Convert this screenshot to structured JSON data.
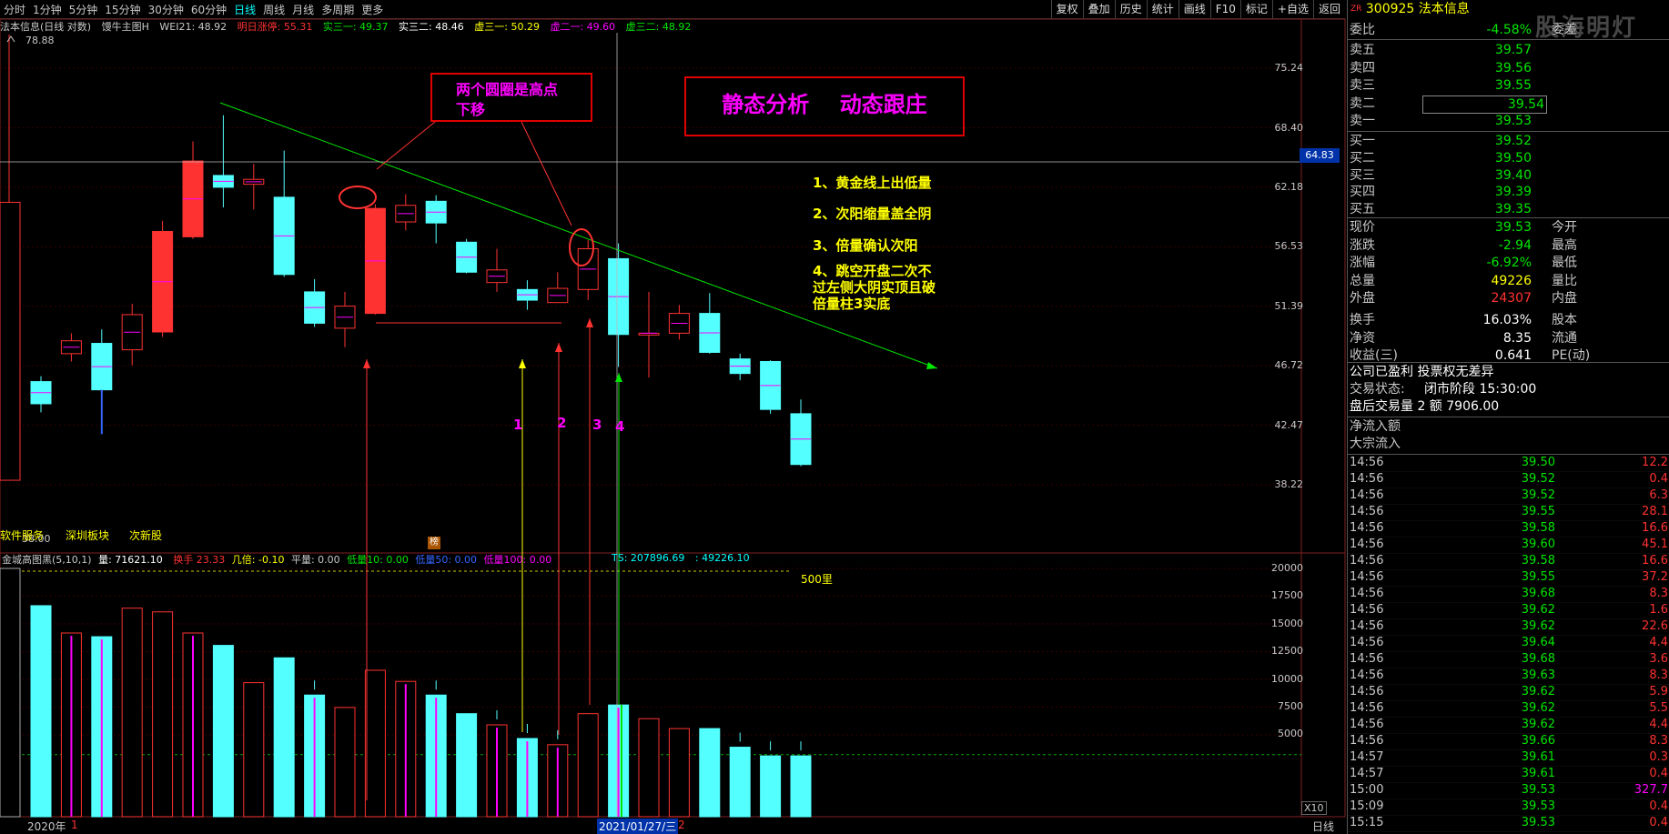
{
  "toolbar": {
    "tabs": [
      "分时",
      "1分钟",
      "5分钟",
      "15分钟",
      "30分钟",
      "60分钟",
      "日线",
      "周线",
      "月线",
      "多周期",
      "更多"
    ],
    "active": "日线",
    "right_buttons": [
      "复权",
      "叠加",
      "历史",
      "统计",
      "画线",
      "F10",
      "标记",
      "+自选",
      "返回"
    ]
  },
  "chart": {
    "title": "法本信息(日线 对数)",
    "indicator_name": "馒牛主图H",
    "wei": "WEI21: 48.92",
    "mingri": "明日涨停: 55.31",
    "shi31": "实三一: 49.37",
    "shi32": "实三二: 48.46",
    "xu31": "虚三一: 50.29",
    "xu21": "虚二一: 49.60",
    "xu32": "虚三二: 48.92",
    "high_mark": "78.88",
    "low_mark": "38.00",
    "price_axis": [
      "75.24",
      "68.40",
      "62.18",
      "56.53",
      "51.39",
      "46.72",
      "42.47",
      "38.22"
    ],
    "crosshair_price": "64.83",
    "bottom_tags": [
      "软件服务",
      "深圳板块",
      "次新股"
    ],
    "vol_axis": [
      "20000",
      "17500",
      "15000",
      "12500",
      "10000",
      "7500",
      "5000"
    ],
    "vol_axis_unit": "X10",
    "date_axis": [
      "2020年",
      "1",
      "2021/01/27/三",
      "2"
    ],
    "daily_label": "日线",
    "marker_500": "500里",
    "bang": "榜"
  },
  "volume_header": {
    "name": "金城高图黑(5,10,1)",
    "liang": "量: 71621.10",
    "huanshou": "换手",
    "huanshou_val": "23.33",
    "jixin": "几倍: -0.10",
    "pingliang": "平量: 0.00",
    "diliang10": "低量10: 0.00",
    "diliang50": "低量50: 0.00",
    "diliang100": "低量100: 0.00",
    "ts": "TS: 207896.69",
    "ts2": ": 49226.10"
  },
  "annotations": {
    "box1_line1": "两个圆圈是高点",
    "box1_line2": "下移",
    "box2": "静态分析    动态跟庄",
    "note1": "1、黄金线上出低量",
    "note2": "2、次阳缩量盖全阴",
    "note3": "3、倍量确认次阳",
    "note4_l1": "4、跳空开盘二次不",
    "note4_l2": "过左侧大阴实顶且破",
    "note4_l3": "倍量柱3实底",
    "num1": "1",
    "num2": "2",
    "num3": "3",
    "num4": "4"
  },
  "panel": {
    "code": "300925",
    "name": "法本信息",
    "code_prefix": "ZR",
    "watermark": "股海明灯",
    "weibi_label": "委比",
    "weibi": "-4.58%",
    "weicha_label": "委差",
    "asks": [
      {
        "label": "卖五",
        "price": "39.57"
      },
      {
        "label": "卖四",
        "price": "39.56"
      },
      {
        "label": "卖三",
        "price": "39.55"
      },
      {
        "label": "卖二",
        "price": "39.54"
      },
      {
        "label": "卖一",
        "price": "39.53"
      }
    ],
    "bids": [
      {
        "label": "买一",
        "price": "39.52"
      },
      {
        "label": "买二",
        "price": "39.50"
      },
      {
        "label": "买三",
        "price": "39.40"
      },
      {
        "label": "买四",
        "price": "39.39"
      },
      {
        "label": "买五",
        "price": "39.35"
      }
    ],
    "stats": [
      {
        "l": "现价",
        "v": "39.53",
        "c": "green",
        "r": "今开"
      },
      {
        "l": "涨跌",
        "v": "-2.94",
        "c": "green",
        "r": "最高"
      },
      {
        "l": "涨幅",
        "v": "-6.92%",
        "c": "green",
        "r": "最低"
      },
      {
        "l": "总量",
        "v": "49226",
        "c": "yellow",
        "r": "量比"
      },
      {
        "l": "外盘",
        "v": "24307",
        "c": "red",
        "r": "内盘"
      },
      {
        "l": "换手",
        "v": "16.03%",
        "c": "white",
        "r": "股本"
      },
      {
        "l": "净资",
        "v": "8.35",
        "c": "white",
        "r": "流通"
      },
      {
        "l": "收益(三)",
        "v": "0.641",
        "c": "white",
        "r": "PE(动)"
      }
    ],
    "status1": "公司已盈利 投票权无差异",
    "status2_label": "交易状态:",
    "status2": "闭市阶段 15:30:00",
    "status3": "盘后交易量 2 额 7906.00",
    "netflow": "净流入额",
    "bigflow": "大宗流入",
    "ticks": [
      {
        "t": "14:56",
        "p": "39.50",
        "v": "12.2"
      },
      {
        "t": "14:56",
        "p": "39.52",
        "v": "0.4"
      },
      {
        "t": "14:56",
        "p": "39.52",
        "v": "6.3"
      },
      {
        "t": "14:56",
        "p": "39.55",
        "v": "28.1"
      },
      {
        "t": "14:56",
        "p": "39.58",
        "v": "16.6"
      },
      {
        "t": "14:56",
        "p": "39.60",
        "v": "45.1"
      },
      {
        "t": "14:56",
        "p": "39.58",
        "v": "16.6"
      },
      {
        "t": "14:56",
        "p": "39.55",
        "v": "37.2"
      },
      {
        "t": "14:56",
        "p": "39.68",
        "v": "8.3"
      },
      {
        "t": "14:56",
        "p": "39.62",
        "v": "1.6"
      },
      {
        "t": "14:56",
        "p": "39.62",
        "v": "22.6"
      },
      {
        "t": "14:56",
        "p": "39.64",
        "v": "4.4"
      },
      {
        "t": "14:56",
        "p": "39.68",
        "v": "3.6"
      },
      {
        "t": "14:56",
        "p": "39.63",
        "v": "8.3"
      },
      {
        "t": "14:56",
        "p": "39.62",
        "v": "5.9"
      },
      {
        "t": "14:56",
        "p": "39.62",
        "v": "5.5"
      },
      {
        "t": "14:56",
        "p": "39.62",
        "v": "4.4"
      },
      {
        "t": "14:56",
        "p": "39.66",
        "v": "8.3"
      },
      {
        "t": "14:57",
        "p": "39.61",
        "v": "0.3"
      },
      {
        "t": "14:57",
        "p": "39.61",
        "v": "0.4"
      },
      {
        "t": "15:00",
        "p": "39.53",
        "v": "327.7"
      },
      {
        "t": "15:09",
        "p": "39.53",
        "v": "0.4"
      },
      {
        "t": "15:15",
        "p": "39.53",
        "v": "0.4"
      }
    ]
  },
  "chart_data": {
    "type": "candlestick",
    "candles": [
      {
        "o": 43.6,
        "c": 45.2,
        "h": 45.6,
        "l": 43.0,
        "dir": "down",
        "v": 17000
      },
      {
        "o": 47.3,
        "c": 48.3,
        "h": 48.9,
        "l": 46.7,
        "dir": "up",
        "v": 14800
      },
      {
        "o": 48.1,
        "c": 44.6,
        "h": 49.2,
        "l": 42.3,
        "dir": "down",
        "v": 14500
      },
      {
        "o": 47.6,
        "c": 50.4,
        "h": 51.3,
        "l": 46.4,
        "dir": "up",
        "v": 16800
      },
      {
        "o": 49.0,
        "c": 57.7,
        "h": 58.7,
        "l": 48.6,
        "dir": "up",
        "v": 16500
      },
      {
        "o": 57.2,
        "c": 64.7,
        "h": 66.8,
        "l": 57.0,
        "dir": "up",
        "v": 14800
      },
      {
        "o": 62.0,
        "c": 63.2,
        "h": 69.7,
        "l": 60.0,
        "dir": "down",
        "v": 13800
      },
      {
        "o": 62.3,
        "c": 62.8,
        "h": 64.4,
        "l": 59.8,
        "dir": "up",
        "v": 10800
      },
      {
        "o": 61.0,
        "c": 53.8,
        "h": 65.8,
        "l": 53.6,
        "dir": "down",
        "v": 12800
      },
      {
        "o": 52.3,
        "c": 49.7,
        "h": 53.4,
        "l": 49.4,
        "dir": "down",
        "v": 9800
      },
      {
        "o": 49.3,
        "c": 51.1,
        "h": 52.3,
        "l": 47.8,
        "dir": "up",
        "v": 8800
      },
      {
        "o": 50.5,
        "c": 59.9,
        "h": 60.3,
        "l": 50.4,
        "dir": "up",
        "v": 11800
      },
      {
        "o": 58.6,
        "c": 60.2,
        "h": 61.3,
        "l": 57.8,
        "dir": "up",
        "v": 10900
      },
      {
        "o": 60.6,
        "c": 58.5,
        "h": 61.2,
        "l": 56.6,
        "dir": "down",
        "v": 9800
      },
      {
        "o": 56.7,
        "c": 54.0,
        "h": 57.0,
        "l": 53.9,
        "dir": "down",
        "v": 8300
      },
      {
        "o": 53.1,
        "c": 54.2,
        "h": 56.1,
        "l": 52.3,
        "dir": "up",
        "v": 7400
      },
      {
        "o": 52.5,
        "c": 51.6,
        "h": 53.3,
        "l": 50.8,
        "dir": "down",
        "v": 6300
      },
      {
        "o": 51.4,
        "c": 52.6,
        "h": 54.0,
        "l": 51.4,
        "dir": "up",
        "v": 5800
      },
      {
        "o": 52.5,
        "c": 56.1,
        "h": 56.9,
        "l": 51.6,
        "dir": "up",
        "v": 8300
      },
      {
        "o": 55.2,
        "c": 48.8,
        "h": 56.6,
        "l": 46.3,
        "dir": "down",
        "v": 9000
      },
      {
        "o": 48.9,
        "c": 48.9,
        "h": 52.3,
        "l": 45.5,
        "dir": "up",
        "v": 7900
      },
      {
        "o": 48.9,
        "c": 50.5,
        "h": 51.2,
        "l": 48.4,
        "dir": "up",
        "v": 7100
      },
      {
        "o": 50.5,
        "c": 47.4,
        "h": 52.2,
        "l": 47.3,
        "dir": "down",
        "v": 7100
      },
      {
        "o": 46.9,
        "c": 45.8,
        "h": 47.3,
        "l": 45.3,
        "dir": "down",
        "v": 5600
      },
      {
        "o": 46.7,
        "c": 43.2,
        "h": 46.8,
        "l": 42.9,
        "dir": "down",
        "v": 4900
      },
      {
        "o": 42.9,
        "c": 39.5,
        "h": 43.9,
        "l": 39.4,
        "dir": "down",
        "v": 4900
      }
    ]
  }
}
